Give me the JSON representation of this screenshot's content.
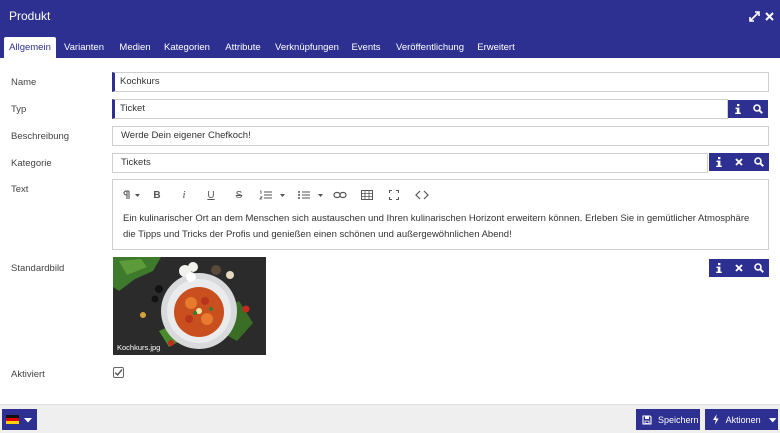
{
  "window": {
    "title": "Produkt",
    "maximize_icon": "expand-icon",
    "close_icon": "close-icon"
  },
  "tabs": [
    {
      "label": "Allgemein",
      "active": true
    },
    {
      "label": "Varianten"
    },
    {
      "label": "Medien"
    },
    {
      "label": "Kategorien"
    },
    {
      "label": "Attribute"
    },
    {
      "label": "Verknüpfungen"
    },
    {
      "label": "Events"
    },
    {
      "label": "Veröffentlichung"
    },
    {
      "label": "Erweitert"
    }
  ],
  "form": {
    "name": {
      "label": "Name",
      "value": "Kochkurs"
    },
    "typ": {
      "label": "Typ",
      "value": "Ticket"
    },
    "beschreibung": {
      "label": "Beschreibung",
      "value": "Werde Dein eigener Chefkoch!"
    },
    "kategorie": {
      "label": "Kategorie",
      "value": "Tickets"
    },
    "text": {
      "label": "Text",
      "value": "Ein kulinarischer Ort an dem Menschen sich austauschen und Ihren kulinarischen Horizont erweitern können. Erleben Sie in gemütlicher Atmosphäre die Tipps und Tricks der Profis und genießen einen schönen und außergewöhnlichen Abend!"
    },
    "standardbild": {
      "label": "Standardbild",
      "filename": "Kochkurs.jpg"
    },
    "aktiviert": {
      "label": "Aktiviert",
      "checked": true
    }
  },
  "footer": {
    "language_icon": "german-flag-icon",
    "save_label": "Speichern",
    "actions_label": "Aktionen"
  },
  "colors": {
    "primary": "#2d3091",
    "border": "#cfcfcf",
    "footer_bg": "#efefef"
  }
}
